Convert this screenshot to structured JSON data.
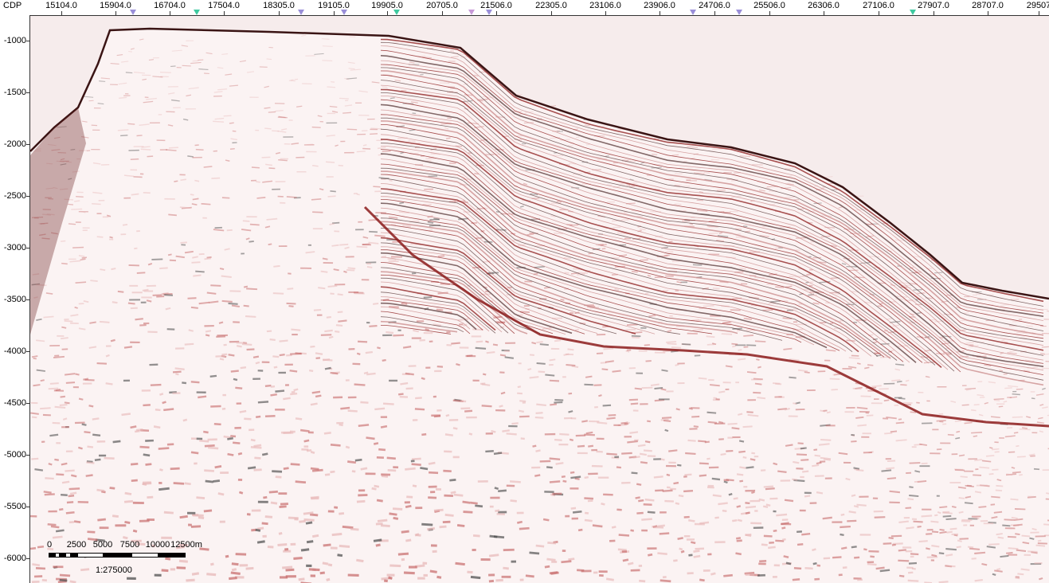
{
  "axes": {
    "cdp_title": "CDP",
    "cdp_labels": [
      "15104.0",
      "15904.0",
      "16704.0",
      "17504.0",
      "18305.0",
      "19105.0",
      "19905.0",
      "20705.0",
      "21506.0",
      "22305.0",
      "23106.0",
      "23906.0",
      "24706.0",
      "25506.0",
      "26306.0",
      "27106.0",
      "27907.0",
      "28707.0",
      "29507"
    ],
    "depth_labels": [
      "-1000",
      "-1500",
      "-2000",
      "-2500",
      "-3000",
      "-3500",
      "-4000",
      "-4500",
      "-5000",
      "-5500",
      "-6000"
    ]
  },
  "well_markers": [
    {
      "color": "#9a8fd8"
    },
    {
      "color": "#3fc9a0"
    },
    {
      "color": "#9a8fd8"
    },
    {
      "color": "#9a8fd8"
    },
    {
      "color": "#3fc9a0"
    },
    {
      "color": "#c89ad8"
    },
    {
      "color": "#9a8fd8"
    },
    {
      "color": "#9a8fd8"
    },
    {
      "color": "#9a8fd8"
    },
    {
      "color": "#3fc9a0"
    }
  ],
  "scale_bar": {
    "labels": [
      "0",
      "2500",
      "5000",
      "7500",
      "10000",
      "12500m"
    ],
    "ratio": "1:275000"
  },
  "colors": {
    "background": "#f6ecec",
    "amplitude_positive": "#8b1a1a",
    "amplitude_negative": "#4a4a4a",
    "noise": "#e7b7b7"
  }
}
